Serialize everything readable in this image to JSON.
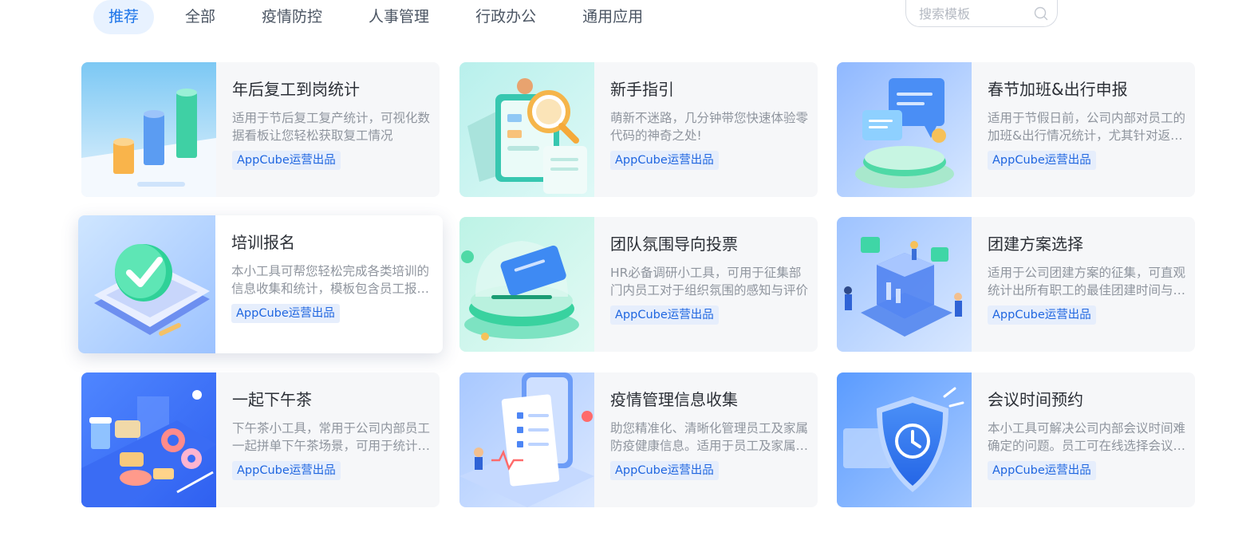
{
  "tabs": [
    "推荐",
    "全部",
    "疫情防控",
    "人事管理",
    "行政办公",
    "通用应用"
  ],
  "search": {
    "placeholder": "搜索模板"
  },
  "badge_label": "AppCube运营出品",
  "cards": [
    {
      "title": "年后复工到岗统计",
      "desc": "适用于节后复工复产统计，可视化数据看板让您轻松获取复工情况",
      "badge": "AppCube运营出品",
      "icon": "bar-chart-illustration"
    },
    {
      "title": "新手指引",
      "desc": "萌新不迷路，几分钟带您快速体验零代码的神奇之处!",
      "badge": "AppCube运营出品",
      "icon": "magnifier-document-illustration"
    },
    {
      "title": "春节加班&出行申报",
      "desc": "适用于节假日前，公司内部对员工的加班&出行情况统计，尤其针对返乡人员的统计",
      "badge": "AppCube运营出品",
      "icon": "chat-bubbles-illustration"
    },
    {
      "title": "培训报名",
      "desc": "本小工具可帮您轻松完成各类培训的信息收集和统计，模板包含员工报名信息",
      "badge": "AppCube运营出品",
      "icon": "checkmark-illustration"
    },
    {
      "title": "团队氛围导向投票",
      "desc": "HR必备调研小工具，可用于征集部门内员工对于组织氛围的感知与评价",
      "badge": "AppCube运营出品",
      "icon": "ballot-box-illustration"
    },
    {
      "title": "团建方案选择",
      "desc": "适用于公司团建方案的征集，可直观统计出所有职工的最佳团建时间与方案",
      "badge": "AppCube运营出品",
      "icon": "team-building-illustration"
    },
    {
      "title": "一起下午茶",
      "desc": "下午茶小工具，常用于公司内部员工一起拼单下午茶场景，可用于统计订单",
      "badge": "AppCube运营出品",
      "icon": "afternoon-tea-illustration"
    },
    {
      "title": "疫情管理信息收集",
      "desc": "助您精准化、清晰化管理员工及家属防疫健康信息。适用于员工及家属信息登记",
      "badge": "AppCube运营出品",
      "icon": "health-form-illustration"
    },
    {
      "title": "会议时间预约",
      "desc": "本小工具可解决公司内部会议时间难确定的问题。员工可在线选择会议时间",
      "badge": "AppCube运营出品",
      "icon": "shield-clock-illustration"
    }
  ],
  "colors": {
    "accent": "#1a73e8",
    "tab_active_bg": "#e8f2ff",
    "badge_bg": "#e6eefc",
    "card_bg": "#f6f7f9"
  }
}
